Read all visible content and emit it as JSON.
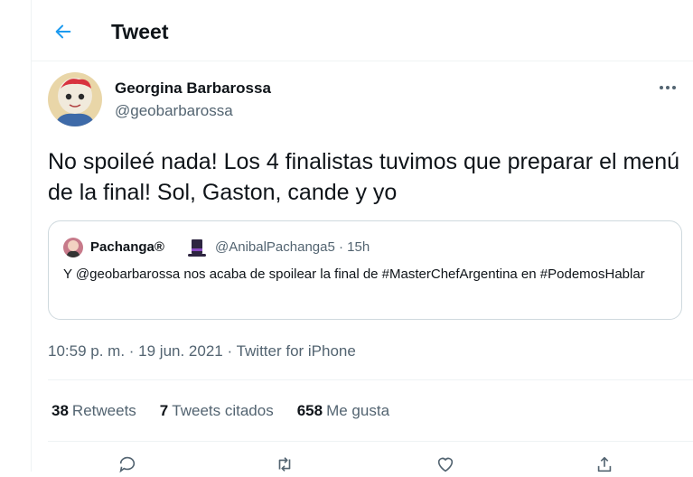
{
  "header": {
    "title": "Tweet",
    "back_icon": "arrow-left-icon"
  },
  "tweet": {
    "author_name": "Georgina Barbarossa",
    "author_handle": "@geobarbarossa",
    "text": "No spoileé nada! Los 4 finalistas tuvimos que preparar el menú de la final! Sol, Gaston, cande y yo",
    "timestamp": "10:59 p. m. · 19 jun. 2021",
    "source_separator": " · ",
    "source": "Twitter for iPhone"
  },
  "quote": {
    "author_name": "Pachanga®",
    "meta": "@AnibalPachanga5 · 15h",
    "text": "Y @geobarbarossa nos acaba de spoilear la final de #MasterChefArgentina  en #PodemosHablar"
  },
  "stats": {
    "retweets_count": "38",
    "retweets_label": "Retweets",
    "quotes_count": "7",
    "quotes_label": "Tweets citados",
    "likes_count": "658",
    "likes_label": "Me gusta"
  },
  "colors": {
    "accent": "#1d9bf0",
    "secondary_text": "#536471",
    "border": "#cfd9de"
  }
}
